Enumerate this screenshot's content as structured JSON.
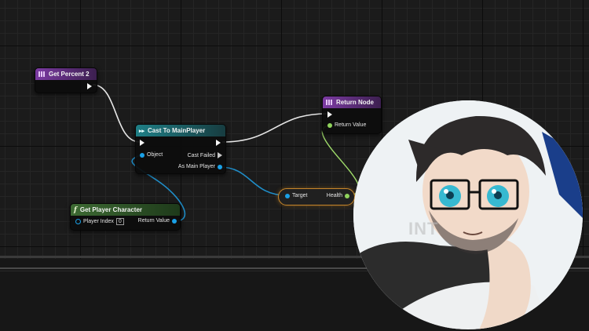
{
  "nodes": {
    "get_percent": {
      "title": "Get Percent 2"
    },
    "cast": {
      "title": "Cast To MainPlayer",
      "object_label": "Object",
      "cast_failed_label": "Cast Failed",
      "as_main_player_label": "As Main Player"
    },
    "return_node": {
      "title": "Return Node",
      "return_value_label": "Return Value"
    },
    "get_player_character": {
      "title": "Get Player Character",
      "player_index_label": "Player Index",
      "player_index_value": "0",
      "return_value_label": "Return Value"
    },
    "health_getter": {
      "target_label": "Target",
      "health_label": "Health"
    }
  },
  "overlay": {
    "watermark": "INT"
  },
  "colors": {
    "exec_wire": "#e6e6e6",
    "object_wire": "#1f8ec9",
    "float_wire": "#9fdc6a",
    "purple_header": "#7c3ba3",
    "teal_header": "#1f7f86",
    "green_header": "#3d6a33",
    "highlight": "#c7862a"
  }
}
